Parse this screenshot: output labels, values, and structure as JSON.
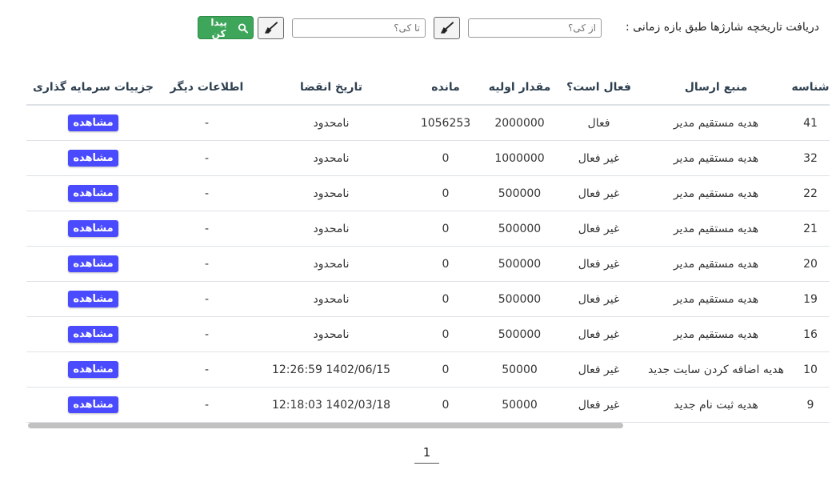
{
  "filter": {
    "label": "دریافت تاریخچه شارژها طبق بازه زمانی :",
    "from_placeholder": "از کی؟",
    "to_placeholder": "تا کی؟",
    "find_label": "پیدا کن",
    "find_color": "#3ea65a"
  },
  "table": {
    "headers": {
      "id": "شناسه",
      "source": "منبع ارسال",
      "active": "فعال است؟",
      "initial": "مقدار اولیه",
      "remaining": "مانده",
      "expiry": "تاریخ انقضا",
      "other": "اطلاعات دیگر",
      "details": "جزییات سرمایه گذاری"
    },
    "rows": [
      {
        "id": "41",
        "source": "هدیه مستقیم مدیر",
        "active": "فعال",
        "initial": "2000000",
        "remaining": "1056253",
        "expiry": "نامحدود",
        "other": "-",
        "details": "مشاهده"
      },
      {
        "id": "32",
        "source": "هدیه مستقیم مدیر",
        "active": "غیر فعال",
        "initial": "1000000",
        "remaining": "0",
        "expiry": "نامحدود",
        "other": "-",
        "details": "مشاهده"
      },
      {
        "id": "22",
        "source": "هدیه مستقیم مدیر",
        "active": "غیر فعال",
        "initial": "500000",
        "remaining": "0",
        "expiry": "نامحدود",
        "other": "-",
        "details": "مشاهده"
      },
      {
        "id": "21",
        "source": "هدیه مستقیم مدیر",
        "active": "غیر فعال",
        "initial": "500000",
        "remaining": "0",
        "expiry": "نامحدود",
        "other": "-",
        "details": "مشاهده"
      },
      {
        "id": "20",
        "source": "هدیه مستقیم مدیر",
        "active": "غیر فعال",
        "initial": "500000",
        "remaining": "0",
        "expiry": "نامحدود",
        "other": "-",
        "details": "مشاهده"
      },
      {
        "id": "19",
        "source": "هدیه مستقیم مدیر",
        "active": "غیر فعال",
        "initial": "500000",
        "remaining": "0",
        "expiry": "نامحدود",
        "other": "-",
        "details": "مشاهده"
      },
      {
        "id": "16",
        "source": "هدیه مستقیم مدیر",
        "active": "غیر فعال",
        "initial": "500000",
        "remaining": "0",
        "expiry": "نامحدود",
        "other": "-",
        "details": "مشاهده"
      },
      {
        "id": "10",
        "source": "هدیه اضافه کردن سایت جدید",
        "active": "غیر فعال",
        "initial": "50000",
        "remaining": "0",
        "expiry": "1402/06/15  12:26:59",
        "other": "-",
        "details": "مشاهده"
      },
      {
        "id": "9",
        "source": "هدیه ثبت نام جدید",
        "active": "غیر فعال",
        "initial": "50000",
        "remaining": "0",
        "expiry": "1402/03/18  12:18:03",
        "other": "-",
        "details": "مشاهده"
      }
    ]
  },
  "pagination": {
    "current": "1"
  },
  "colors": {
    "view_button": "#4a4aff",
    "header_text": "#2f4050"
  }
}
